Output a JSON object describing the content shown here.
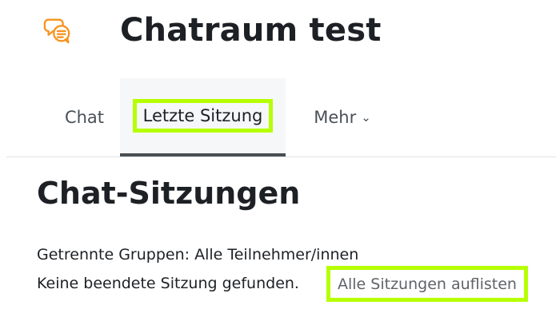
{
  "header": {
    "icon": "chat-bubbles-icon",
    "title": "Chatraum test",
    "accent_color": "#f7931e"
  },
  "secondary_nav": {
    "tabs": [
      {
        "label": "Chat",
        "active": false
      },
      {
        "label": "Letzte Sitzung",
        "active": true
      },
      {
        "label": "Mehr",
        "active": false,
        "icon": "chevron-down-icon",
        "chevron_glyph": "⌄"
      }
    ]
  },
  "main": {
    "heading": "Chat-Sitzungen",
    "group_filter": "Getrennte Gruppen: Alle Teilnehmer/innen",
    "no_session_text": "Keine beendete Sitzung gefunden.",
    "list_all_link": "Alle Sitzungen auflisten"
  },
  "colors": {
    "highlight": "#b6ff00",
    "active_tab_underline": "#4a4f55"
  }
}
